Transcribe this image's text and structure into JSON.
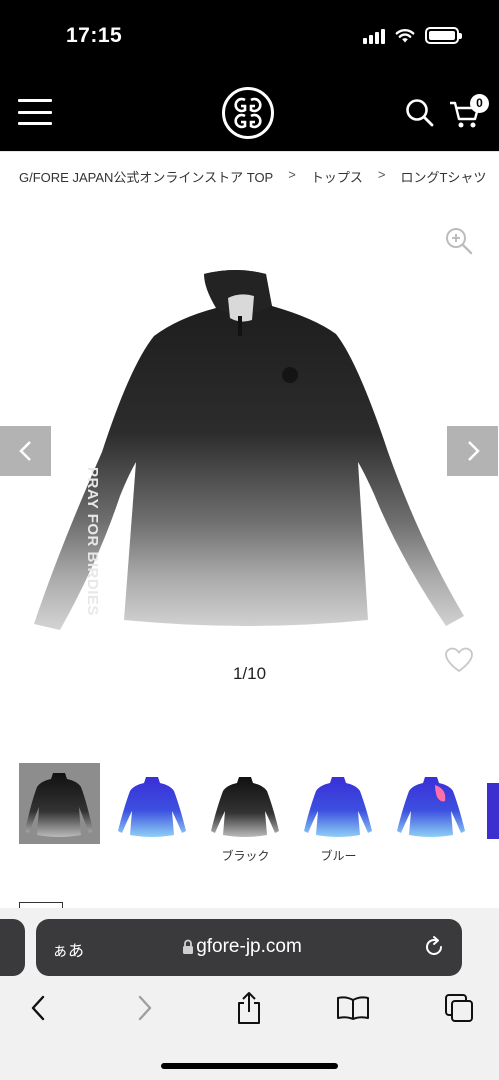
{
  "status_bar": {
    "time": "17:15"
  },
  "header": {
    "cart_count": "0"
  },
  "breadcrumb": {
    "items": [
      "G/FORE JAPAN公式オンラインストア TOP",
      "トップス",
      "ロングTシャツ"
    ],
    "separator": ">"
  },
  "gallery": {
    "counter": "1/10",
    "sleeve_print": "PRAY FOR BIRDIES",
    "total_images": 10,
    "current_image": 1
  },
  "thumbnails": {
    "labels": [
      "ブラック",
      "ブルー"
    ]
  },
  "browser": {
    "aa_label": "ぁあ",
    "url": "gfore-jp.com"
  },
  "colors": {
    "header_bg": "#000000",
    "arrow_bg": "#b3b3b3",
    "urlbar_bg": "#3a3a3c",
    "blue_shirt": "#3b36d8",
    "black_shirt": "#1c1c1c"
  }
}
